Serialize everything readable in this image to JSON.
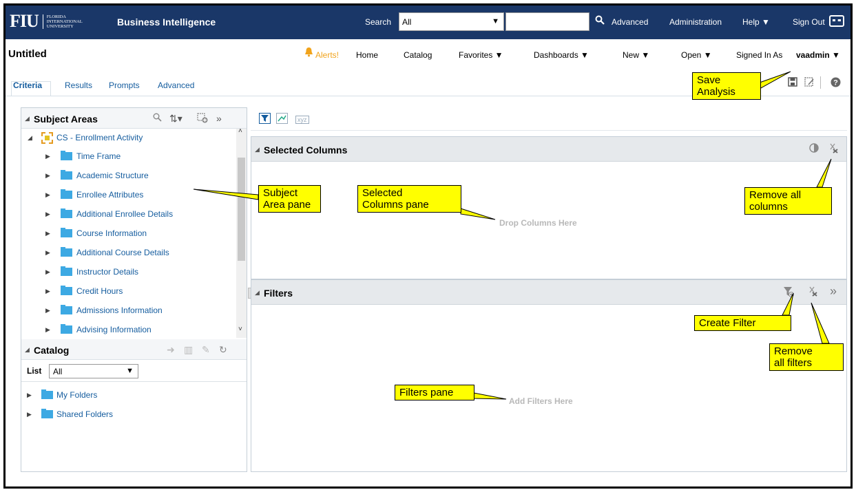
{
  "topbar": {
    "logo_text": "FIU",
    "logo_sub_line1": "FLORIDA",
    "logo_sub_line2": "INTERNATIONAL",
    "logo_sub_line3": "UNIVERSITY",
    "title": "Business Intelligence",
    "search_label": "Search",
    "search_scope": "All",
    "advanced": "Advanced",
    "administration": "Administration",
    "help": "Help ▼",
    "sign_out": "Sign Out"
  },
  "header": {
    "page_title": "Untitled",
    "alerts": "Alerts!",
    "home": "Home",
    "catalog": "Catalog",
    "favorites": "Favorites ▼",
    "dashboards": "Dashboards ▼",
    "new": "New ▼",
    "open": "Open ▼",
    "signed_in_as": "Signed In As",
    "user": "vaadmin ▼"
  },
  "tabs": [
    "Criteria",
    "Results",
    "Prompts",
    "Advanced"
  ],
  "subject_areas": {
    "title": "Subject Areas",
    "root": "CS - Enrollment Activity",
    "folders": [
      "Time Frame",
      "Academic Structure",
      "Enrollee Attributes",
      "Additional Enrollee Details",
      "Course Information",
      "Additional Course Details",
      "Instructor Details",
      "Credit Hours",
      "Admissions Information",
      "Advising Information"
    ]
  },
  "catalog": {
    "title": "Catalog",
    "list_label": "List",
    "list_value": "All",
    "folders": [
      "My Folders",
      "Shared Folders"
    ]
  },
  "selected_columns": {
    "title": "Selected Columns",
    "placeholder": "Drop Columns Here"
  },
  "filters": {
    "title": "Filters",
    "placeholder": "Add Filters Here"
  },
  "callouts": {
    "save_line1": "Save",
    "save_line2": "Analysis",
    "subject_line1": "Subject",
    "subject_line2": "Area pane",
    "selected_line1": "Selected",
    "selected_line2": "Columns pane",
    "remove_cols_line1": "Remove all",
    "remove_cols_line2": "columns",
    "create_filter": "Create Filter",
    "remove_filters_line1": "Remove",
    "remove_filters_line2": "all filters",
    "filters_pane": "Filters pane"
  },
  "colors": {
    "topbar": "#1a3768",
    "link": "#145c9e",
    "folder": "#3da9e3",
    "callout": "#ffff00",
    "alert": "#f1a31b"
  }
}
